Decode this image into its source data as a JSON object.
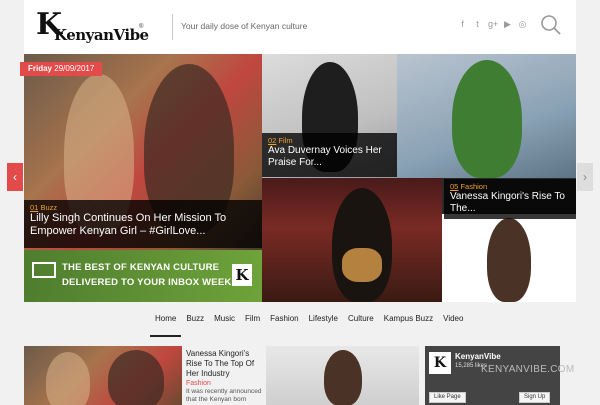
{
  "header": {
    "logo_k": "K",
    "logo_word": "KenyanVibe",
    "logo_reg": "®",
    "tagline": "Your daily dose of Kenyan culture",
    "social_icons": [
      "f",
      "t",
      "g+",
      "▶",
      "◎"
    ]
  },
  "featured": {
    "date_day": "Friday",
    "date": "29/09/2017",
    "items": [
      {
        "num": "01",
        "category": "Buzz",
        "title": "Lilly Singh Continues On Her Mission To Empower Kenyan Girl – #GirlLove..."
      },
      {
        "num": "02",
        "category": "Film",
        "title": "Ava Duvernay Voices Her Praise For..."
      },
      {
        "num": "05",
        "category": "Fashion",
        "title": "Vanessa Kingori's Rise To The..."
      }
    ]
  },
  "promo": {
    "line1": "THE BEST OF KENYAN CULTURE",
    "line2": "DELIVERED TO YOUR INBOX WEEKLY",
    "logo": "K"
  },
  "slider_controls": {
    "prev": "‹",
    "next": "›"
  },
  "nav": {
    "items": [
      "Home",
      "Buzz",
      "Music",
      "Film",
      "Fashion",
      "Lifestyle",
      "Culture",
      "Kampus Buzz",
      "Video"
    ],
    "active": "Home"
  },
  "article_card": {
    "title": "Vanessa Kingori's Rise To The Top Of Her Industry",
    "category": "Fashion",
    "excerpt": "It was recently announced that the Kenyan born"
  },
  "facebook": {
    "logo": "K",
    "name": "KenyanVibe",
    "likes": "15,285 likes",
    "site": "KENYANVIBE.COM",
    "like_btn": "Like Page",
    "signup_btn": "Sign Up"
  },
  "colors": {
    "accent": "#e34b4b",
    "promo_green": "#5c8f34",
    "category_orange": "#f0a030"
  }
}
